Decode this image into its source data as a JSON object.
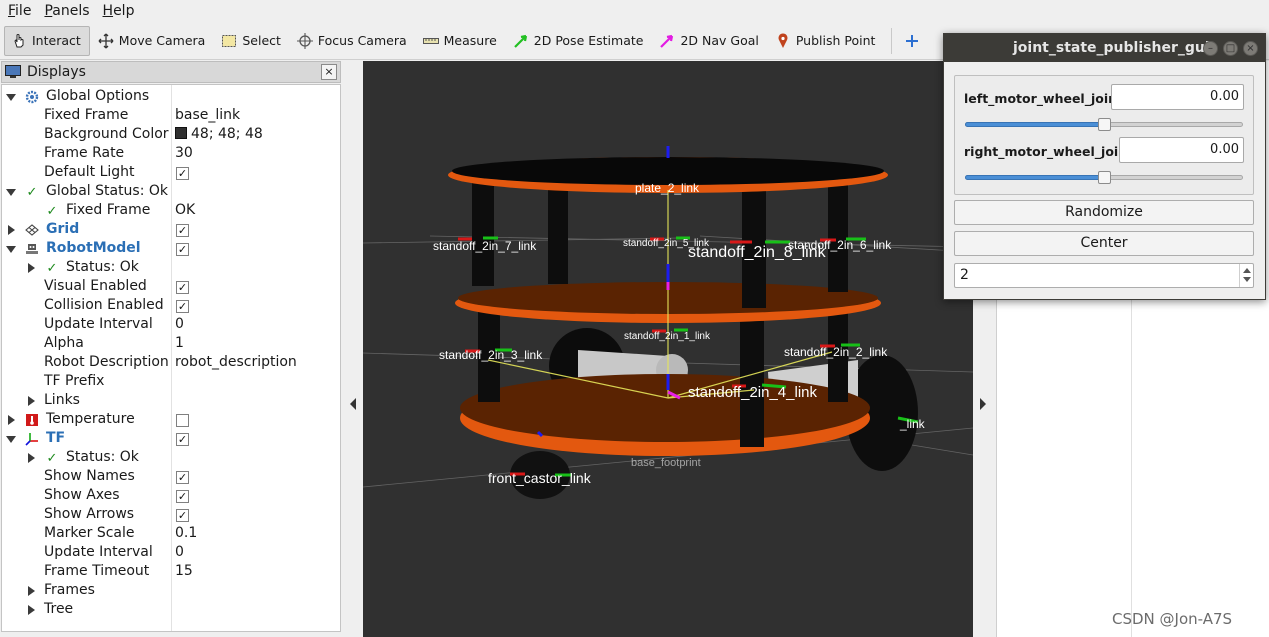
{
  "menubar": {
    "items": [
      {
        "label": "File",
        "key": "F",
        "rest": "ile"
      },
      {
        "label": "Panels",
        "key": "P",
        "rest": "anels"
      },
      {
        "label": "Help",
        "key": "H",
        "rest": "elp"
      }
    ]
  },
  "toolbar": {
    "interact": "Interact",
    "move_camera": "Move Camera",
    "select": "Select",
    "focus_camera": "Focus Camera",
    "measure": "Measure",
    "pose_estimate": "2D Pose Estimate",
    "nav_goal": "2D Nav Goal",
    "publish_point": "Publish Point"
  },
  "displays": {
    "title": "Displays",
    "close_glyph": "×",
    "rows": {
      "global_options": "Global Options",
      "fixed_frame": {
        "name": "Fixed Frame",
        "value": "base_link"
      },
      "background_color": {
        "name": "Background Color",
        "value": "48; 48; 48",
        "color": "#303030"
      },
      "frame_rate": {
        "name": "Frame Rate",
        "value": "30"
      },
      "default_light": "Default Light",
      "global_status": "Global Status: Ok",
      "gs_fixed_frame": {
        "name": "Fixed Frame",
        "value": "OK"
      },
      "grid": "Grid",
      "robot_model": "RobotModel",
      "rm_status": "Status: Ok",
      "visual_enabled": "Visual Enabled",
      "collision_enabled": "Collision Enabled",
      "update_interval": {
        "name": "Update Interval",
        "value": "0"
      },
      "alpha": {
        "name": "Alpha",
        "value": "1"
      },
      "robot_description": {
        "name": "Robot Description",
        "value": "robot_description"
      },
      "tf_prefix": "TF Prefix",
      "links": "Links",
      "temperature": "Temperature",
      "tf": "TF",
      "tf_status": "Status: Ok",
      "show_names": "Show Names",
      "show_axes": "Show Axes",
      "show_arrows": "Show Arrows",
      "marker_scale": {
        "name": "Marker Scale",
        "value": "0.1"
      },
      "tf_update_interval": {
        "name": "Update Interval",
        "value": "0"
      },
      "frame_timeout": {
        "name": "Frame Timeout",
        "value": "15"
      },
      "frames": "Frames",
      "tree": "Tree"
    },
    "check_glyph": "✓"
  },
  "viewport": {
    "frame_labels": {
      "plate_2": "plate_2_link",
      "standoff_7": "standoff_2in_7_link",
      "standoff_5": "standoff_2in_5_link",
      "standoff_8": "standoff_2in_8_link",
      "standoff_6": "standoff_2in_6_link",
      "standoff_1": "standoff_2in_1_link",
      "standoff_3": "standoff_2in_3_link",
      "standoff_2": "standoff_2in_2_link",
      "standoff_4": "standoff_2in_4_link",
      "wheel_link": "_link",
      "front_castor": "front_castor_link",
      "base_footprint": "base_footprint"
    },
    "colors": {
      "background": "#303030",
      "plate": "#e3580f",
      "plate_dark": "#5a2302",
      "standoff": "#0d0d0d",
      "wheel": "#111111",
      "motor": "#c9c9c9"
    }
  },
  "joint_gui": {
    "title": "joint_state_publisher_gui",
    "joints": [
      {
        "name": "left_motor_wheel_joint",
        "value": "0.00",
        "position": 0.5
      },
      {
        "name": "right_motor_wheel_joint",
        "value": "0.00",
        "position": 0.5
      }
    ],
    "randomize": "Randomize",
    "center": "Center",
    "spin_value": "2",
    "window_buttons": {
      "minimize": "–",
      "maximize": "□",
      "close": "×"
    }
  },
  "watermark": "CSDN @Jon-A7S"
}
